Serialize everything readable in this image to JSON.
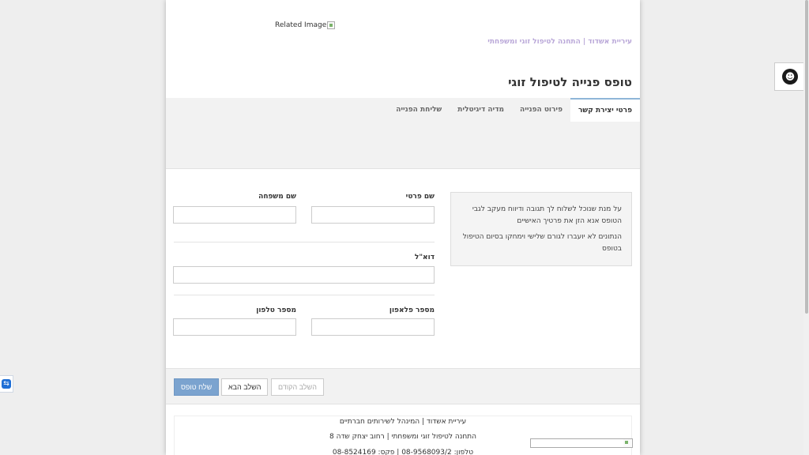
{
  "header": {
    "image_alt": "Related Image",
    "breadcrumb": "עיריית אשדוד | התחנה לטיפול זוגי ומשפחתי",
    "title": "טופס פנייה לטיפול זוגי"
  },
  "tabs": [
    {
      "label": "פרטי יצירת קשר",
      "active": true
    },
    {
      "label": "פירוט הפנייה",
      "active": false
    },
    {
      "label": "מדיה דיגיטלית",
      "active": false
    },
    {
      "label": "שליחת הפנייה",
      "active": false
    }
  ],
  "info_box": {
    "line1": "על מנת שנוכל לשלוח לך תגובה ודיווח מעקב לגבי הטופס אנא הזן את פרטיך האישיים",
    "line2": "הנתונים לא יועברו לגורם שלישי וימחקו בסיום הטיפול בטופס"
  },
  "form": {
    "first_name_label": "שם פרטי",
    "first_name_value": "",
    "last_name_label": "שם משפחה",
    "last_name_value": "",
    "email_label": "דוא\"ל",
    "email_value": "",
    "mobile_label": "מספר פלאפון",
    "mobile_value": "",
    "phone_label": "מספר טלפון",
    "phone_value": ""
  },
  "buttons": {
    "prev": "השלב הקודם",
    "next": "השלב הבא",
    "submit": "שלח טופס"
  },
  "footer": {
    "line1": "עיריית אשדוד | המינהל לשירותים חברתיים",
    "line2": "התחנה לטיפול זוגי ומשפחתי | רחוב יצחק שדה 8",
    "line3": "טלפון: 08-9568093/2 | פקס: 08-8524169"
  },
  "colors": {
    "accent": "#7ba3cf",
    "breadcrumb": "#b9a7d8"
  },
  "icons": {
    "accessibility": "accessibility-icon",
    "teamviewer": "teamviewer-icon"
  }
}
